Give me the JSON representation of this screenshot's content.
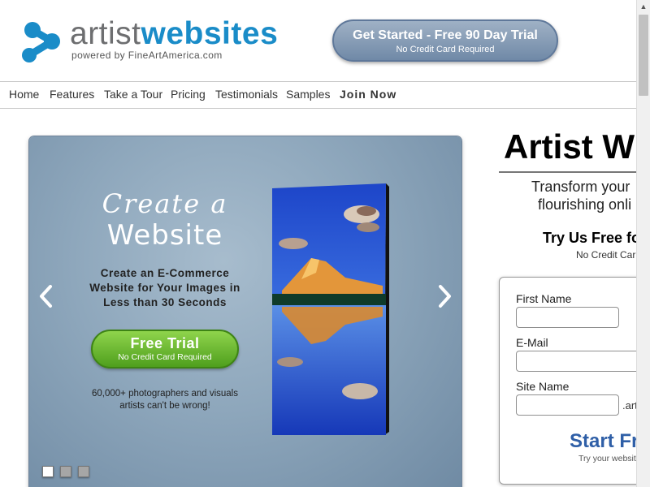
{
  "header": {
    "logo_word1": "artist",
    "logo_word2": "websites",
    "powered_by": "powered by FineArtAmerica.com",
    "cta_main": "Get Started - Free 90 Day Trial",
    "cta_sub": "No Credit Card Required"
  },
  "nav": {
    "items": [
      "Home",
      "Features",
      "Take a Tour",
      "Pricing",
      "Testimonials",
      "Samples",
      "Join Now"
    ]
  },
  "slider": {
    "title_script": "Create a",
    "title_main": "Website",
    "description": "Create an E-Commerce Website for Your Images in Less than 30 Seconds",
    "button_main": "Free Trial",
    "button_sub": "No Credit Card Required",
    "social_proof": "60,000+ photographers and visuals artists can't be wrong!",
    "prev_icon": "chevron-left-icon",
    "next_icon": "chevron-right-icon",
    "active_slide": 1,
    "slide_count": 3
  },
  "signup": {
    "heading": "Artist W",
    "subheading_line1": "Transform your",
    "subheading_line2": "flourishing onli",
    "try_free": "Try Us Free fo",
    "no_cc": "No Credit Car",
    "first_name_label": "First Name",
    "first_name_value": "",
    "email_label": "E-Mail",
    "email_value": "",
    "site_name_label": "Site Name",
    "site_name_value": "",
    "site_suffix": ".art",
    "start_button": "Start Fr",
    "start_sub": "Try your websit"
  },
  "colors": {
    "brand_blue": "#1a8cc8",
    "logo_gray": "#6d6e70",
    "cta_blue": "#7089a7",
    "trial_green": "#5aad24",
    "start_blue": "#2f5fa7"
  }
}
